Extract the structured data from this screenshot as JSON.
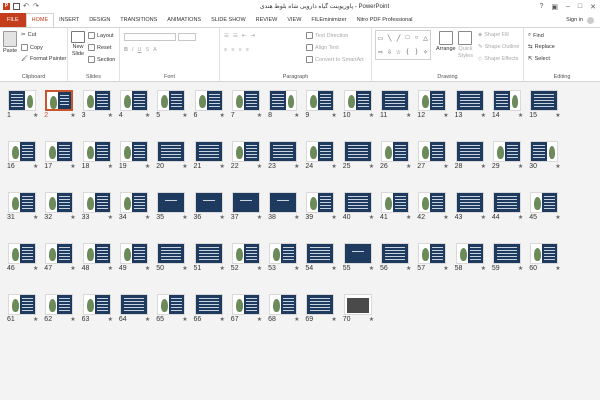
{
  "window": {
    "title": "پاورپوینت گیاه دارویی شاه بلوط هندی - PowerPoint",
    "app_badge": "P"
  },
  "tabs": [
    {
      "label": "FILE",
      "kind": "file"
    },
    {
      "label": "HOME",
      "kind": "active"
    },
    {
      "label": "INSERT"
    },
    {
      "label": "DESIGN"
    },
    {
      "label": "TRANSITIONS"
    },
    {
      "label": "ANIMATIONS"
    },
    {
      "label": "SLIDE SHOW"
    },
    {
      "label": "REVIEW"
    },
    {
      "label": "VIEW"
    },
    {
      "label": "FILEminimizer"
    },
    {
      "label": "Nitro PDF Professional"
    }
  ],
  "signin": "Sign in",
  "ribbon": {
    "clipboard": {
      "label": "Clipboard",
      "paste": "Paste",
      "cut": "Cut",
      "copy": "Copy",
      "format_painter": "Format Painter"
    },
    "slides": {
      "label": "Slides",
      "new_slide": "New",
      "new_slide2": "Slide",
      "layout": "Layout",
      "reset": "Reset",
      "section": "Section"
    },
    "font": {
      "label": "Font"
    },
    "paragraph": {
      "label": "Paragraph",
      "text_direction": "Text Direction",
      "align_text": "Align Text",
      "convert": "Convert to SmartArt"
    },
    "drawing": {
      "label": "Drawing",
      "arrange": "Arrange",
      "quick_styles": "Quick",
      "quick_styles2": "Styles",
      "shape_fill": "Shape Fill",
      "shape_outline": "Shape Outline",
      "shape_effects": "Shape Effects"
    },
    "editing": {
      "label": "Editing",
      "find": "Find",
      "replace": "Replace",
      "select": "Select"
    }
  },
  "slides": {
    "selected": 2,
    "count": 70,
    "star": "★",
    "items": [
      {
        "n": "1",
        "v": "plant-right"
      },
      {
        "n": "2",
        "v": "plant-left"
      },
      {
        "n": "3",
        "v": "plant-left"
      },
      {
        "n": "4",
        "v": "plant-left"
      },
      {
        "n": "5",
        "v": "plant-left"
      },
      {
        "n": "6",
        "v": "plant-left"
      },
      {
        "n": "7",
        "v": "plant-left"
      },
      {
        "n": "8",
        "v": "plant-right"
      },
      {
        "n": "9",
        "v": "plant-left"
      },
      {
        "n": "10",
        "v": "plant-left"
      },
      {
        "n": "11",
        "v": "text-right"
      },
      {
        "n": "12",
        "v": "plant-left"
      },
      {
        "n": "13",
        "v": "text-right"
      },
      {
        "n": "14",
        "v": "plant-right"
      },
      {
        "n": "15",
        "v": "text-right"
      },
      {
        "n": "16",
        "v": "plant-left"
      },
      {
        "n": "17",
        "v": "plant-left"
      },
      {
        "n": "18",
        "v": "plant-left"
      },
      {
        "n": "19",
        "v": "plant-left"
      },
      {
        "n": "20",
        "v": "text-right"
      },
      {
        "n": "21",
        "v": "text-right"
      },
      {
        "n": "22",
        "v": "plant-left"
      },
      {
        "n": "23",
        "v": "text-right"
      },
      {
        "n": "24",
        "v": "plant-left"
      },
      {
        "n": "25",
        "v": "text-right"
      },
      {
        "n": "26",
        "v": "plant-left"
      },
      {
        "n": "27",
        "v": "plant-left"
      },
      {
        "n": "28",
        "v": "text-right"
      },
      {
        "n": "29",
        "v": "plant-left"
      },
      {
        "n": "30",
        "v": "plant-right"
      },
      {
        "n": "31",
        "v": "plant-left"
      },
      {
        "n": "32",
        "v": "plant-left"
      },
      {
        "n": "33",
        "v": "plant-left"
      },
      {
        "n": "34",
        "v": "plant-left"
      },
      {
        "n": "35",
        "v": "full-blue"
      },
      {
        "n": "36",
        "v": "full-blue"
      },
      {
        "n": "37",
        "v": "full-blue"
      },
      {
        "n": "38",
        "v": "full-blue"
      },
      {
        "n": "39",
        "v": "plant-left"
      },
      {
        "n": "40",
        "v": "text-right"
      },
      {
        "n": "41",
        "v": "plant-left"
      },
      {
        "n": "42",
        "v": "plant-left"
      },
      {
        "n": "43",
        "v": "text-right"
      },
      {
        "n": "44",
        "v": "text-right"
      },
      {
        "n": "45",
        "v": "plant-left"
      },
      {
        "n": "46",
        "v": "plant-left"
      },
      {
        "n": "47",
        "v": "plant-left"
      },
      {
        "n": "48",
        "v": "plant-left"
      },
      {
        "n": "49",
        "v": "plant-left"
      },
      {
        "n": "50",
        "v": "text-right"
      },
      {
        "n": "51",
        "v": "text-right"
      },
      {
        "n": "52",
        "v": "plant-left"
      },
      {
        "n": "53",
        "v": "plant-left"
      },
      {
        "n": "54",
        "v": "text-right"
      },
      {
        "n": "55",
        "v": "full-blue"
      },
      {
        "n": "56",
        "v": "text-right"
      },
      {
        "n": "57",
        "v": "plant-left"
      },
      {
        "n": "58",
        "v": "plant-left"
      },
      {
        "n": "59",
        "v": "text-right"
      },
      {
        "n": "60",
        "v": "plant-left"
      },
      {
        "n": "61",
        "v": "plant-left"
      },
      {
        "n": "62",
        "v": "plant-left"
      },
      {
        "n": "63",
        "v": "plant-left"
      },
      {
        "n": "64",
        "v": "text-right"
      },
      {
        "n": "65",
        "v": "plant-left"
      },
      {
        "n": "66",
        "v": "text-right"
      },
      {
        "n": "67",
        "v": "plant-left"
      },
      {
        "n": "68",
        "v": "plant-left"
      },
      {
        "n": "69",
        "v": "text-right"
      },
      {
        "n": "70",
        "v": "photo"
      }
    ]
  },
  "colors": {
    "accent": "#c43e1c",
    "selection": "#c8552c",
    "slide_blue": "#1f3a5f",
    "plant_green": "#6d8a5a"
  }
}
